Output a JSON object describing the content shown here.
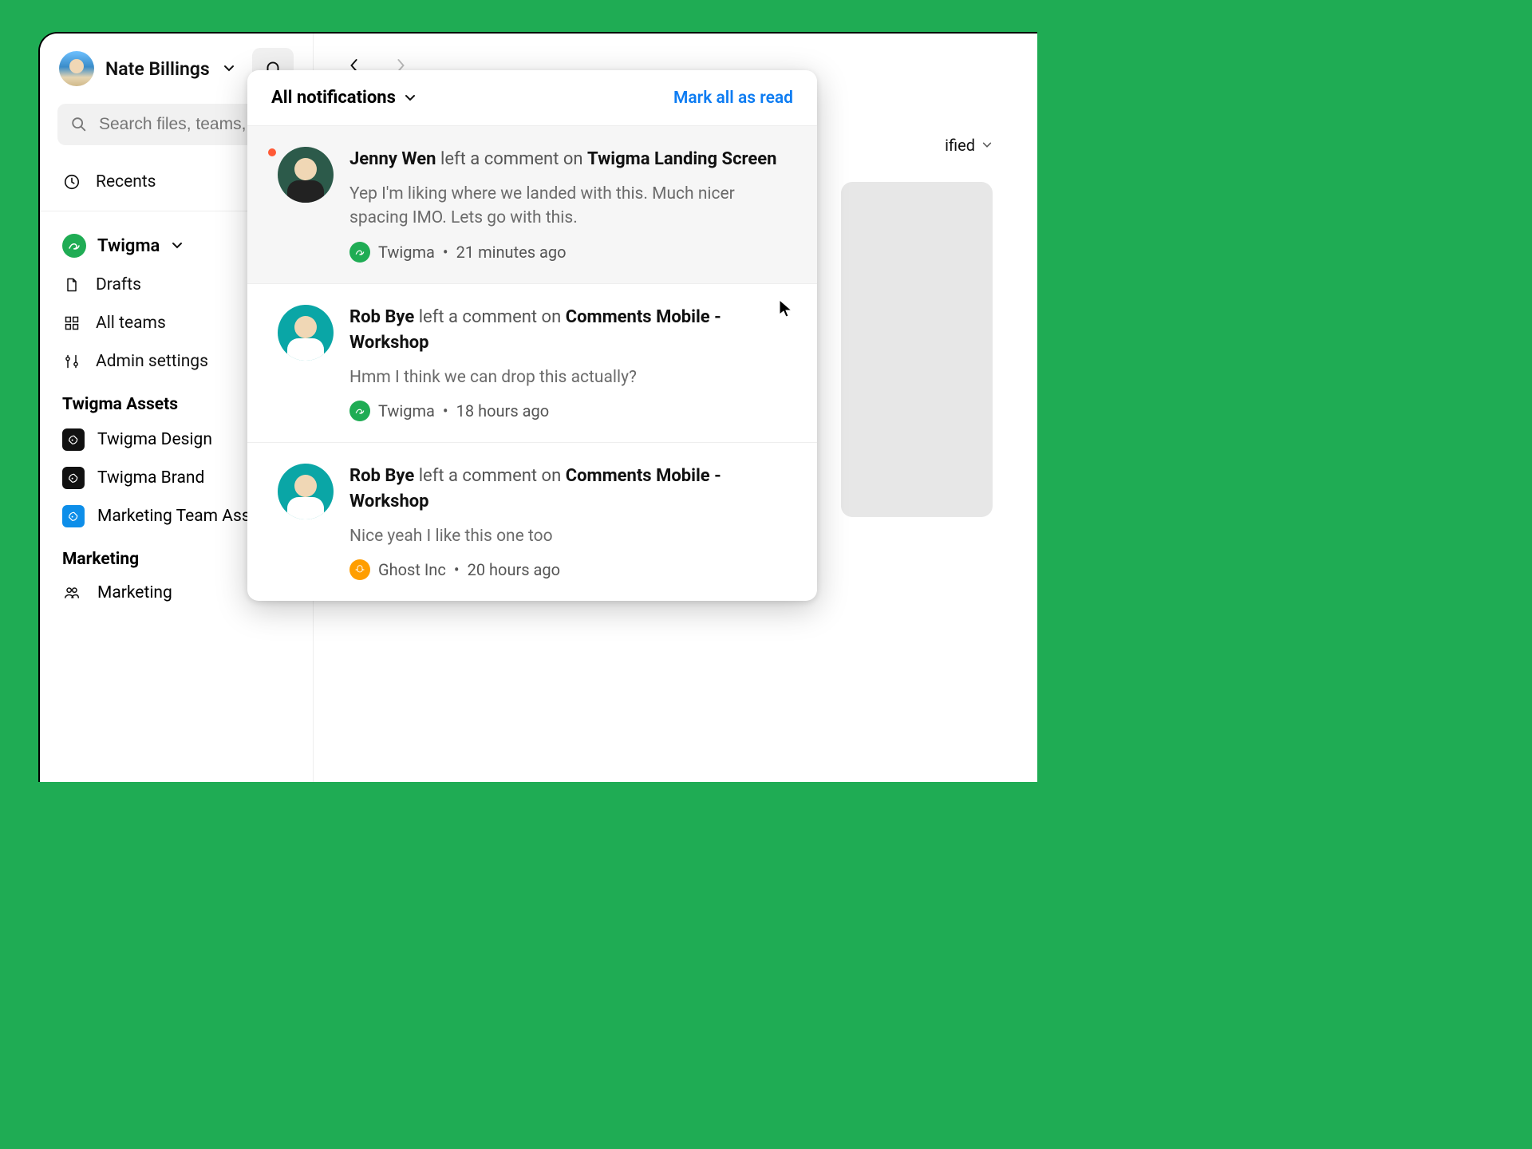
{
  "user": {
    "name": "Nate Billings"
  },
  "search": {
    "placeholder": "Search files, teams, p"
  },
  "sidebar": {
    "recents": "Recents",
    "team_name": "Twigma",
    "drafts": "Drafts",
    "all_teams": "All teams",
    "admin": "Admin settings",
    "assets_header": "Twigma Assets",
    "assets": [
      {
        "label": "Twigma Design",
        "color": "black"
      },
      {
        "label": "Twigma Brand",
        "color": "black"
      },
      {
        "label": "Marketing Team Assets",
        "color": "blue"
      }
    ],
    "marketing_header": "Marketing",
    "marketing_item": "Marketing"
  },
  "main": {
    "sort_label": "ified"
  },
  "notifications": {
    "filter_label": "All notifications",
    "mark_all": "Mark all as read",
    "items": [
      {
        "actor": "Jenny Wen",
        "action": "left a comment on",
        "target": "Twigma Landing Screen",
        "body": "Yep I'm liking where we landed with this. Much nicer spacing IMO. Lets go with this.",
        "workspace": "Twigma",
        "time": "21 minutes ago",
        "unread": true,
        "badge": "green"
      },
      {
        "actor": "Rob Bye",
        "action": "left a comment on",
        "target": "Comments Mobile - Workshop",
        "body": "Hmm I think we can drop this actually?",
        "workspace": "Twigma",
        "time": "18 hours ago",
        "unread": false,
        "badge": "green"
      },
      {
        "actor": "Rob Bye",
        "action": "left a comment on",
        "target": "Comments Mobile - Workshop",
        "body": "Nice yeah I like this one too",
        "workspace": "Ghost Inc",
        "time": "20 hours ago",
        "unread": false,
        "badge": "orange"
      }
    ]
  }
}
